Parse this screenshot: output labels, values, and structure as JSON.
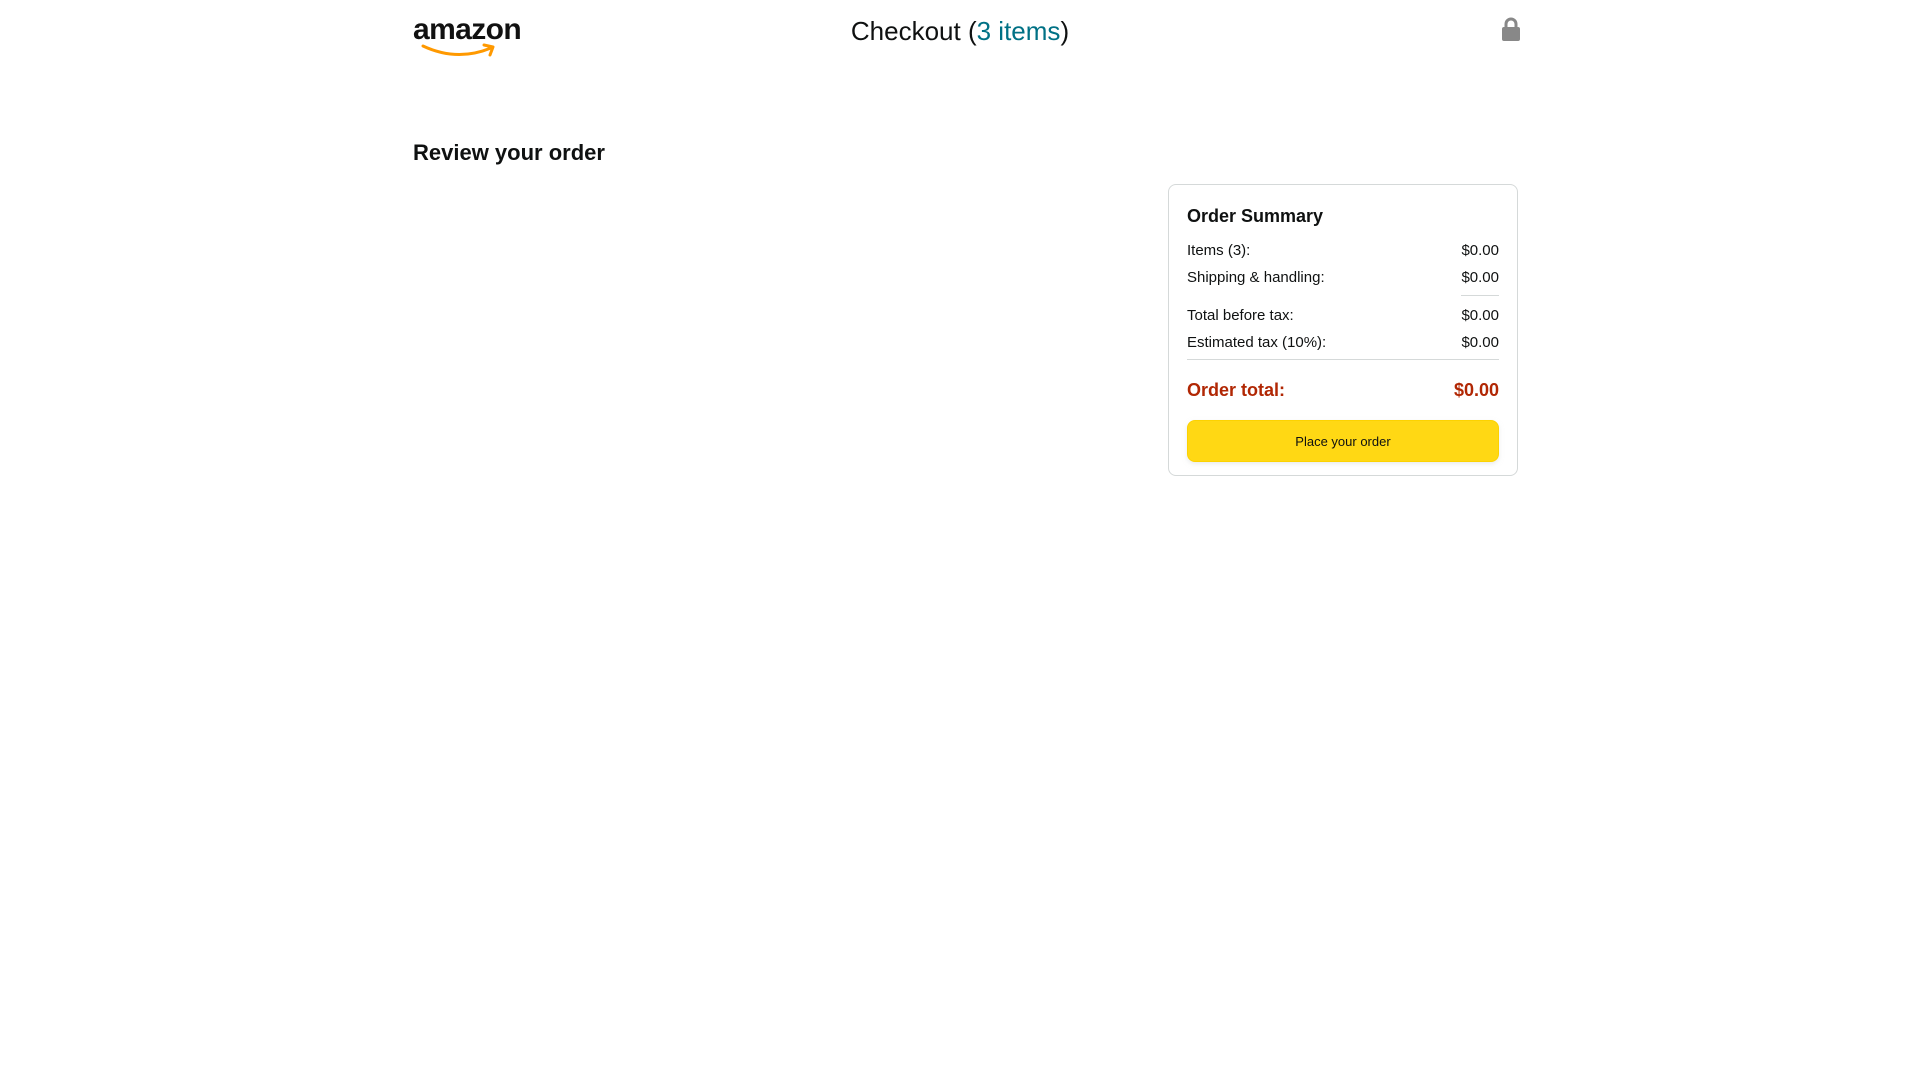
{
  "header": {
    "logo_text": "amazon",
    "title_prefix": "Checkout (",
    "items_link": "3 items",
    "title_suffix": ")",
    "lock_icon": "lock-icon"
  },
  "main": {
    "heading": "Review your order"
  },
  "summary": {
    "title": "Order Summary",
    "rows": [
      {
        "label": "Items (3):",
        "value": "$0.00"
      },
      {
        "label": "Shipping & handling:",
        "value": "$0.00"
      },
      {
        "label": "Total before tax:",
        "value": "$0.00"
      },
      {
        "label": "Estimated tax (10%):",
        "value": "$0.00"
      }
    ],
    "total_label": "Order total:",
    "total_value": "$0.00",
    "button_label": "Place your order"
  },
  "colors": {
    "link": "#007185",
    "total": "#b12704",
    "button": "#ffd814",
    "smile": "#ff9900"
  }
}
